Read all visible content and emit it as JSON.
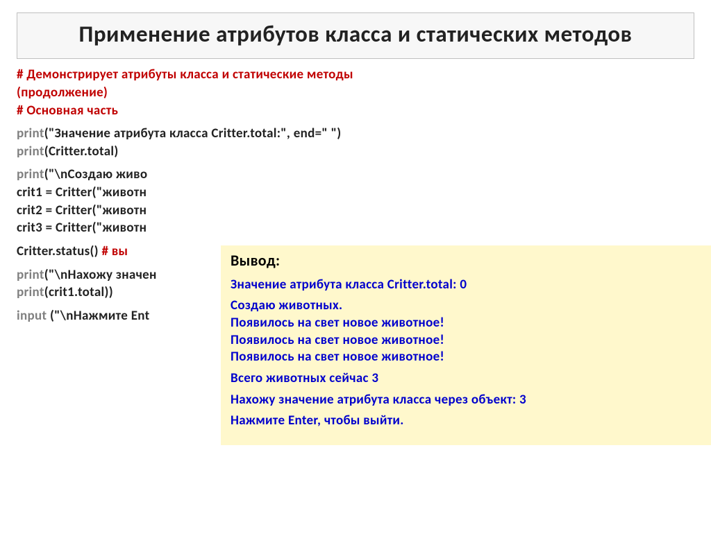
{
  "title": "Применение атрибутов класса и статических  методов",
  "comment1_line1": "# Демонстрирует атрибуты класса и статические методы",
  "comment1_line2": "(продолжение)",
  "comment2": "# Основная часть",
  "code": {
    "l1a": "print",
    "l1b": "(\"Значение атрибута класса Critter.total:\", end=\" \")",
    "l2a": "print",
    "l2b": "(Critter.total)",
    "l3a": "print",
    "l3b": "(\"\\nСоздаю живо",
    "l4": "crit1 = Critter(\"животн",
    "l5": "crit2 = Critter(\"животн",
    "l6": "crit3 = Critter(\"животн",
    "l7a": "Critter.status()       ",
    "l7b": "# вы",
    "l8a": "print",
    "l8b": "(\"\\nНахожу значен",
    "l9a": "print",
    "l9b": "(crit1.total))",
    "l10a": "input ",
    "l10b": "(\"\\nНажмите Ent"
  },
  "output": {
    "title": "Вывод:",
    "p1": "Значение атрибута класса Critter.total:  0",
    "p2a": "Создаю животных.",
    "p2b": "Появилось на свет новое животное!",
    "p2c": "Появилось на свет новое животное!",
    "p2d": "Появилось на свет новое животное!",
    "p3": "Всего животных сейчас 3",
    "p4": "Нахожу значение атрибута класса через объект:  3",
    "p5": "Нажмите Enter, чтобы выйти."
  }
}
